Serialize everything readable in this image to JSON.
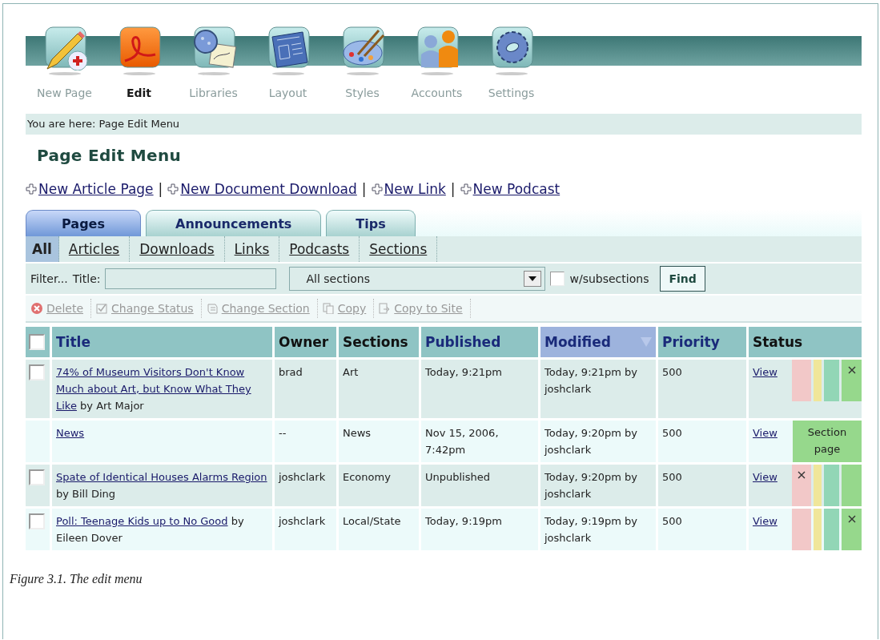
{
  "nav": [
    {
      "label": "New Page",
      "selected": false
    },
    {
      "label": "Edit",
      "selected": true
    },
    {
      "label": "Libraries",
      "selected": false
    },
    {
      "label": "Layout",
      "selected": false
    },
    {
      "label": "Styles",
      "selected": false
    },
    {
      "label": "Accounts",
      "selected": false
    },
    {
      "label": "Settings",
      "selected": false
    }
  ],
  "breadcrumb": "You are here: Page Edit Menu",
  "heading": "Page Edit Menu",
  "new_links": {
    "separator": "|",
    "items": [
      "New Article Page",
      "New Document Download",
      "New Link",
      "New Podcast"
    ]
  },
  "tabs": [
    {
      "label": "Pages",
      "selected": true
    },
    {
      "label": "Announcements",
      "selected": false
    },
    {
      "label": "Tips",
      "selected": false
    }
  ],
  "subtabs": [
    {
      "label": "All",
      "selected": true
    },
    {
      "label": "Articles",
      "selected": false
    },
    {
      "label": "Downloads",
      "selected": false
    },
    {
      "label": "Links",
      "selected": false
    },
    {
      "label": "Podcasts",
      "selected": false
    },
    {
      "label": "Sections",
      "selected": false
    }
  ],
  "filter": {
    "label": "Filter...",
    "title_label": "Title:",
    "section_select": "All sections",
    "subsections": {
      "label": "w/subsections",
      "checked": false
    },
    "button": "Find"
  },
  "actions": [
    {
      "label": "Delete",
      "disabled": true
    },
    {
      "label": "Change Status",
      "disabled": true
    },
    {
      "label": "Change Section",
      "disabled": true
    },
    {
      "label": "Copy",
      "disabled": true
    },
    {
      "label": "Copy to Site",
      "disabled": true
    }
  ],
  "table": {
    "select_all_checked": false,
    "columns": [
      {
        "label": "Title",
        "sortable": true,
        "sorted": false
      },
      {
        "label": "Owner",
        "sortable": false,
        "sorted": false
      },
      {
        "label": "Sections",
        "sortable": false,
        "sorted": false
      },
      {
        "label": "Published",
        "sortable": true,
        "sorted": false
      },
      {
        "label": "Modified",
        "sortable": true,
        "sorted": true
      },
      {
        "label": "Priority",
        "sortable": true,
        "sorted": false
      },
      {
        "label": "Status",
        "sortable": false,
        "sorted": false
      }
    ],
    "rows": [
      {
        "checked": false,
        "title": "74% of Museum Visitors Don't Know Much about Art, but Know What They Like",
        "byline": "by Art Major",
        "owner": "brad",
        "sections": "Art",
        "published": "Today, 9:21pm",
        "modified": "Today, 9:21pm by joshclark",
        "priority": "500",
        "view": "View",
        "status": {
          "kind": "bars",
          "segments": [
            {
              "color": "#f2c8c8",
              "marked": false
            },
            {
              "color": "#f0e69a",
              "marked": false
            },
            {
              "color": "#92d6b6",
              "marked": false
            },
            {
              "color": "#96d88c",
              "marked": true
            }
          ]
        }
      },
      {
        "title": "News",
        "owner": "--",
        "sections": "News",
        "published": "Nov 15, 2006, 7:42pm",
        "modified": "Today, 9:20pm by joshclark",
        "priority": "500",
        "view": "View",
        "status": {
          "kind": "label",
          "text": "Section page"
        }
      },
      {
        "checked": false,
        "title": "Spate of Identical Houses Alarms Region",
        "byline": "by Bill Ding",
        "owner": "joshclark",
        "sections": "Economy",
        "published": "Unpublished",
        "modified": "Today, 9:20pm by joshclark",
        "priority": "500",
        "view": "View",
        "status": {
          "kind": "bars",
          "segments": [
            {
              "color": "#f2c8c8",
              "marked": true
            },
            {
              "color": "#f0e69a",
              "marked": false
            },
            {
              "color": "#92d6b6",
              "marked": false
            },
            {
              "color": "#96d88c",
              "marked": false
            }
          ]
        }
      },
      {
        "checked": false,
        "title": "Poll: Teenage Kids up to No Good",
        "byline": "by Eileen Dover",
        "owner": "joshclark",
        "sections": "Local/State",
        "published": "Today, 9:19pm",
        "modified": "Today, 9:19pm by joshclark",
        "priority": "500",
        "view": "View",
        "status": {
          "kind": "bars",
          "segments": [
            {
              "color": "#f2c8c8",
              "marked": false
            },
            {
              "color": "#f0e69a",
              "marked": false
            },
            {
              "color": "#92d6b6",
              "marked": false
            },
            {
              "color": "#96d88c",
              "marked": true
            }
          ]
        }
      }
    ]
  },
  "caption": "Figure 3.1. The edit menu"
}
